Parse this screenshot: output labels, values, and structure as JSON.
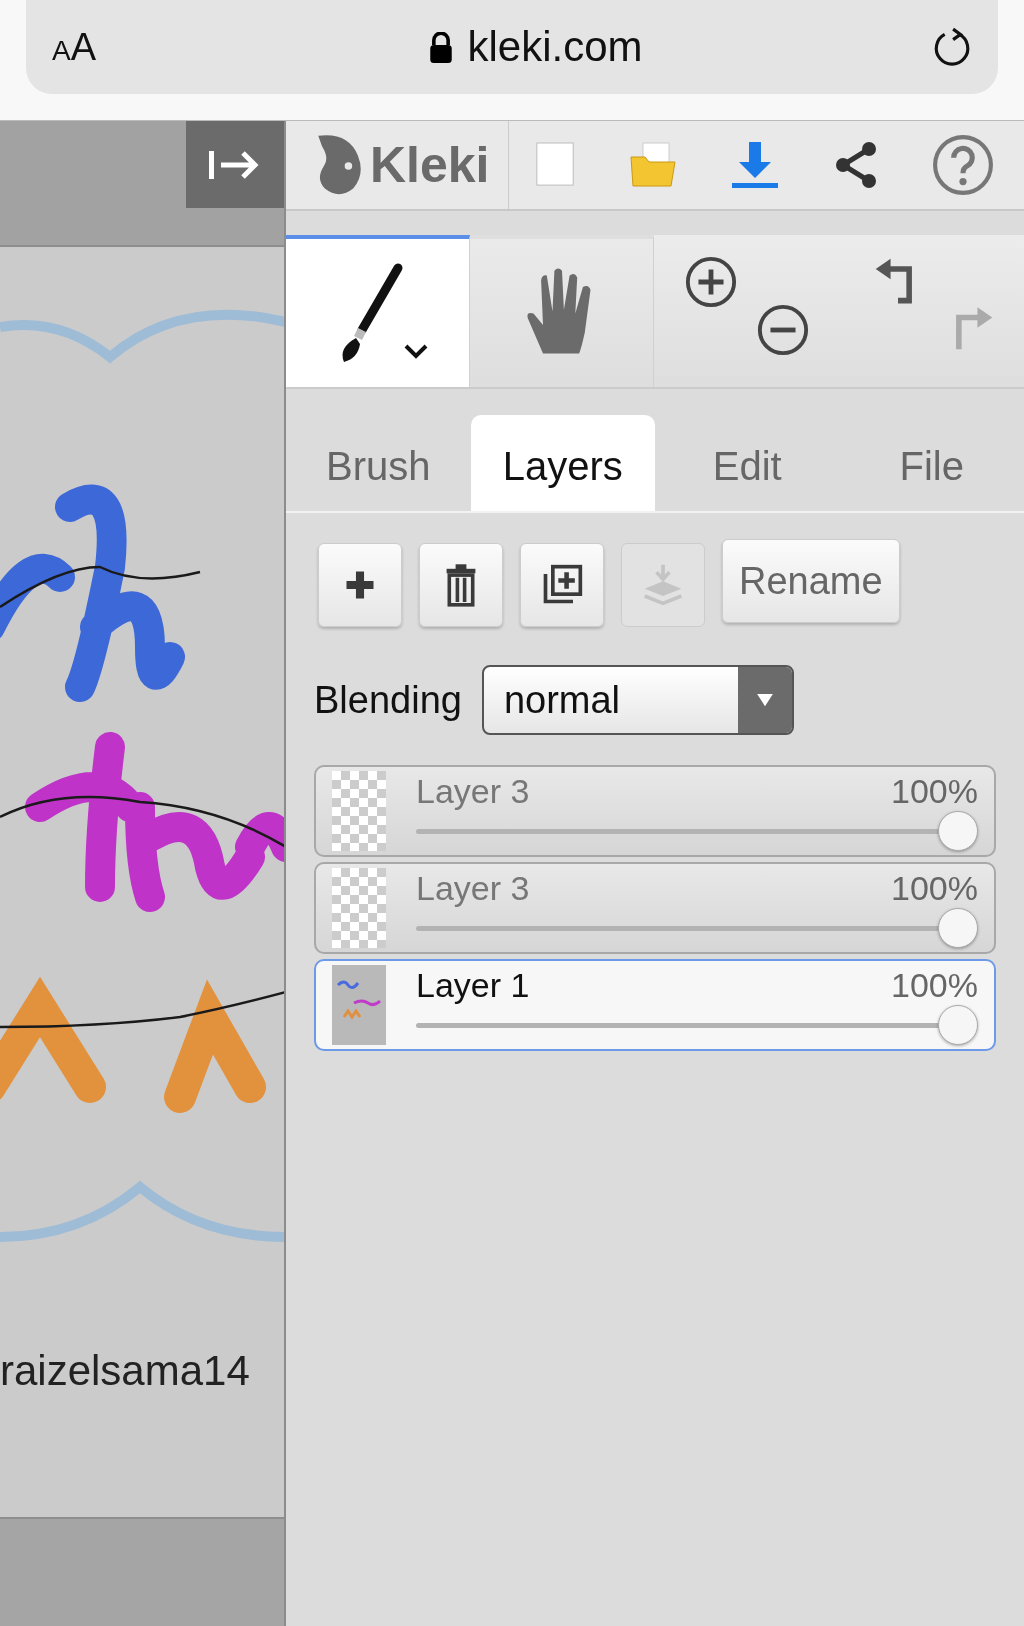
{
  "browser": {
    "text_size_label": "AA",
    "url": "kleki.com"
  },
  "toolbar": {
    "logo_text": "Kleki"
  },
  "tools": [
    {
      "kind": "brush",
      "selected": true
    },
    {
      "kind": "hand",
      "selected": false
    }
  ],
  "history": {
    "undo_disabled": false,
    "redo_disabled": true
  },
  "tabs": [
    {
      "label": "Brush",
      "selected": false
    },
    {
      "label": "Layers",
      "selected": true
    },
    {
      "label": "Edit",
      "selected": false
    },
    {
      "label": "File",
      "selected": false
    }
  ],
  "layer_actions": [
    {
      "kind": "add",
      "disabled": false
    },
    {
      "kind": "delete",
      "disabled": false
    },
    {
      "kind": "duplicate",
      "disabled": false
    },
    {
      "kind": "merge",
      "disabled": true
    },
    {
      "kind": "rename",
      "label": "Rename",
      "disabled": false
    }
  ],
  "blending": {
    "label": "Blending",
    "value": "normal"
  },
  "layers": [
    {
      "name": "Layer 3",
      "opacity": "100%",
      "level": 1,
      "hidden": true,
      "selected": false,
      "thumb_blank": true
    },
    {
      "name": "Layer 3",
      "opacity": "100%",
      "level": 1,
      "hidden": true,
      "selected": false,
      "thumb_blank": true
    },
    {
      "name": "Layer 1",
      "opacity": "100%",
      "level": 1,
      "hidden": false,
      "selected": true,
      "thumb_blank": false
    }
  ],
  "canvas": {
    "signature": "raizelsama14"
  }
}
